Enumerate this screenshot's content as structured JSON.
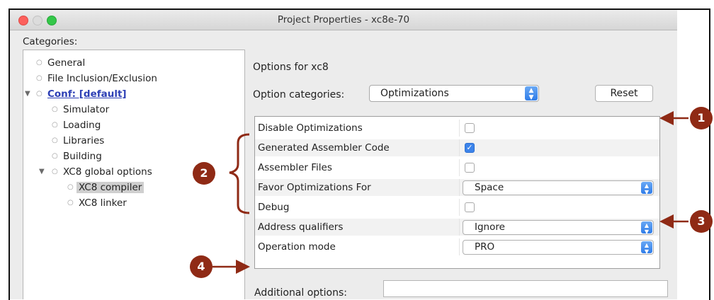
{
  "window": {
    "title": "Project Properties - xc8e-70"
  },
  "categories": {
    "label": "Categories:",
    "items": [
      {
        "label": "General"
      },
      {
        "label": "File Inclusion/Exclusion"
      },
      {
        "label": "Conf: [default]"
      },
      {
        "label": "Simulator"
      },
      {
        "label": "Loading"
      },
      {
        "label": "Libraries"
      },
      {
        "label": "Building"
      },
      {
        "label": "XC8 global options"
      },
      {
        "label": "XC8 compiler"
      },
      {
        "label": "XC8 linker"
      }
    ]
  },
  "options": {
    "heading": "Options for xc8",
    "category_label": "Option categories:",
    "category_value": "Optimizations",
    "reset_label": "Reset",
    "rows": [
      {
        "name": "Disable Optimizations",
        "type": "checkbox",
        "checked": false
      },
      {
        "name": "Generated Assembler Code",
        "type": "checkbox",
        "checked": true
      },
      {
        "name": "Assembler Files",
        "type": "checkbox",
        "checked": false
      },
      {
        "name": "Favor Optimizations For",
        "type": "select",
        "value": "Space"
      },
      {
        "name": "Debug",
        "type": "checkbox",
        "checked": false
      },
      {
        "name": "Address qualifiers",
        "type": "select",
        "value": "Ignore"
      },
      {
        "name": "Operation mode",
        "type": "select",
        "value": "PRO"
      }
    ],
    "additional_label": "Additional options:",
    "additional_value": ""
  },
  "callouts": [
    "1",
    "2",
    "3",
    "4"
  ],
  "colors": {
    "callout": "#8f2a15",
    "link": "#2d3fb5",
    "checkbox_checked": "#3d84ea"
  }
}
